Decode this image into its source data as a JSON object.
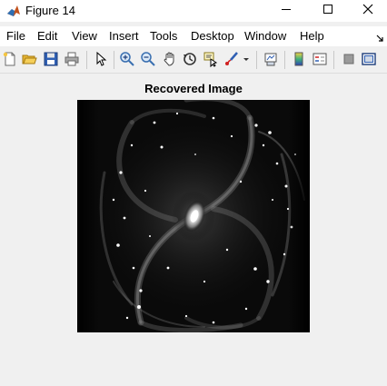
{
  "window": {
    "title": "Figure 14",
    "controls": [
      "minimize",
      "maximize",
      "close"
    ]
  },
  "menu": {
    "items": [
      "File",
      "Edit",
      "View",
      "Insert",
      "Tools",
      "Desktop",
      "Window",
      "Help"
    ]
  },
  "toolbar": {
    "icons": [
      "new-figure-icon",
      "open-file-icon",
      "save-icon",
      "print-icon",
      "pointer-icon",
      "zoom-in-icon",
      "zoom-out-icon",
      "pan-icon",
      "rotate-icon",
      "data-cursor-icon",
      "brush-icon",
      "link-plot-icon",
      "colorbar-icon",
      "legend-icon",
      "hide-plot-tools-icon",
      "show-plot-tools-icon"
    ]
  },
  "figure": {
    "title": "Recovered Image"
  },
  "colors": {
    "titlebar": "#ffffff",
    "menubar": "#ffffff",
    "toolbar": "#f0f0f0",
    "figure_bg": "#f0f0f0",
    "image_bg": "#000000"
  }
}
